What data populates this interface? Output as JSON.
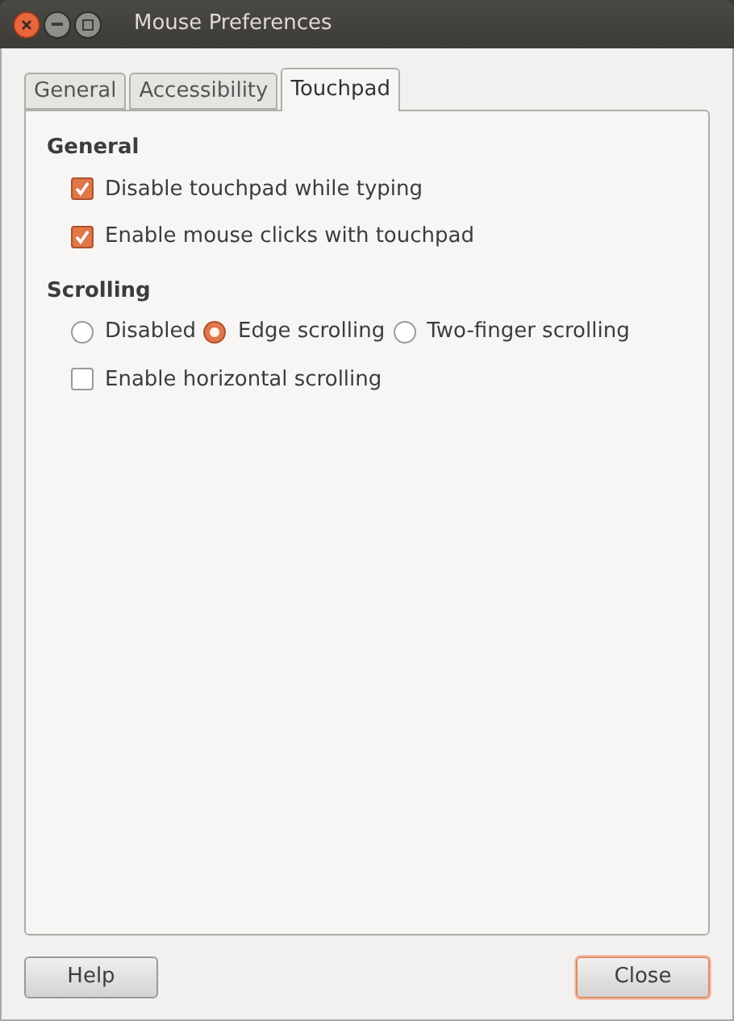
{
  "window": {
    "title": "Mouse Preferences"
  },
  "tabs": [
    {
      "label": "General",
      "selected": false
    },
    {
      "label": "Accessibility",
      "selected": false
    },
    {
      "label": "Touchpad",
      "selected": true
    }
  ],
  "sections": [
    {
      "heading": "General",
      "items": [
        {
          "kind": "checkbox",
          "label": "Disable touchpad while typing",
          "checked": true
        },
        {
          "kind": "checkbox",
          "label": "Enable mouse clicks with touchpad",
          "checked": true
        }
      ]
    },
    {
      "heading": "Scrolling",
      "items": [
        {
          "kind": "radio_group",
          "options": [
            {
              "label": "Disabled",
              "selected": false
            },
            {
              "label": "Edge scrolling",
              "selected": true
            },
            {
              "label": "Two-finger scrolling",
              "selected": false
            }
          ]
        },
        {
          "kind": "checkbox",
          "label": "Enable horizontal scrolling",
          "checked": false
        }
      ]
    }
  ],
  "buttons": [
    {
      "label": "Help",
      "focused": false
    },
    {
      "label": "Close",
      "focused": true
    }
  ]
}
